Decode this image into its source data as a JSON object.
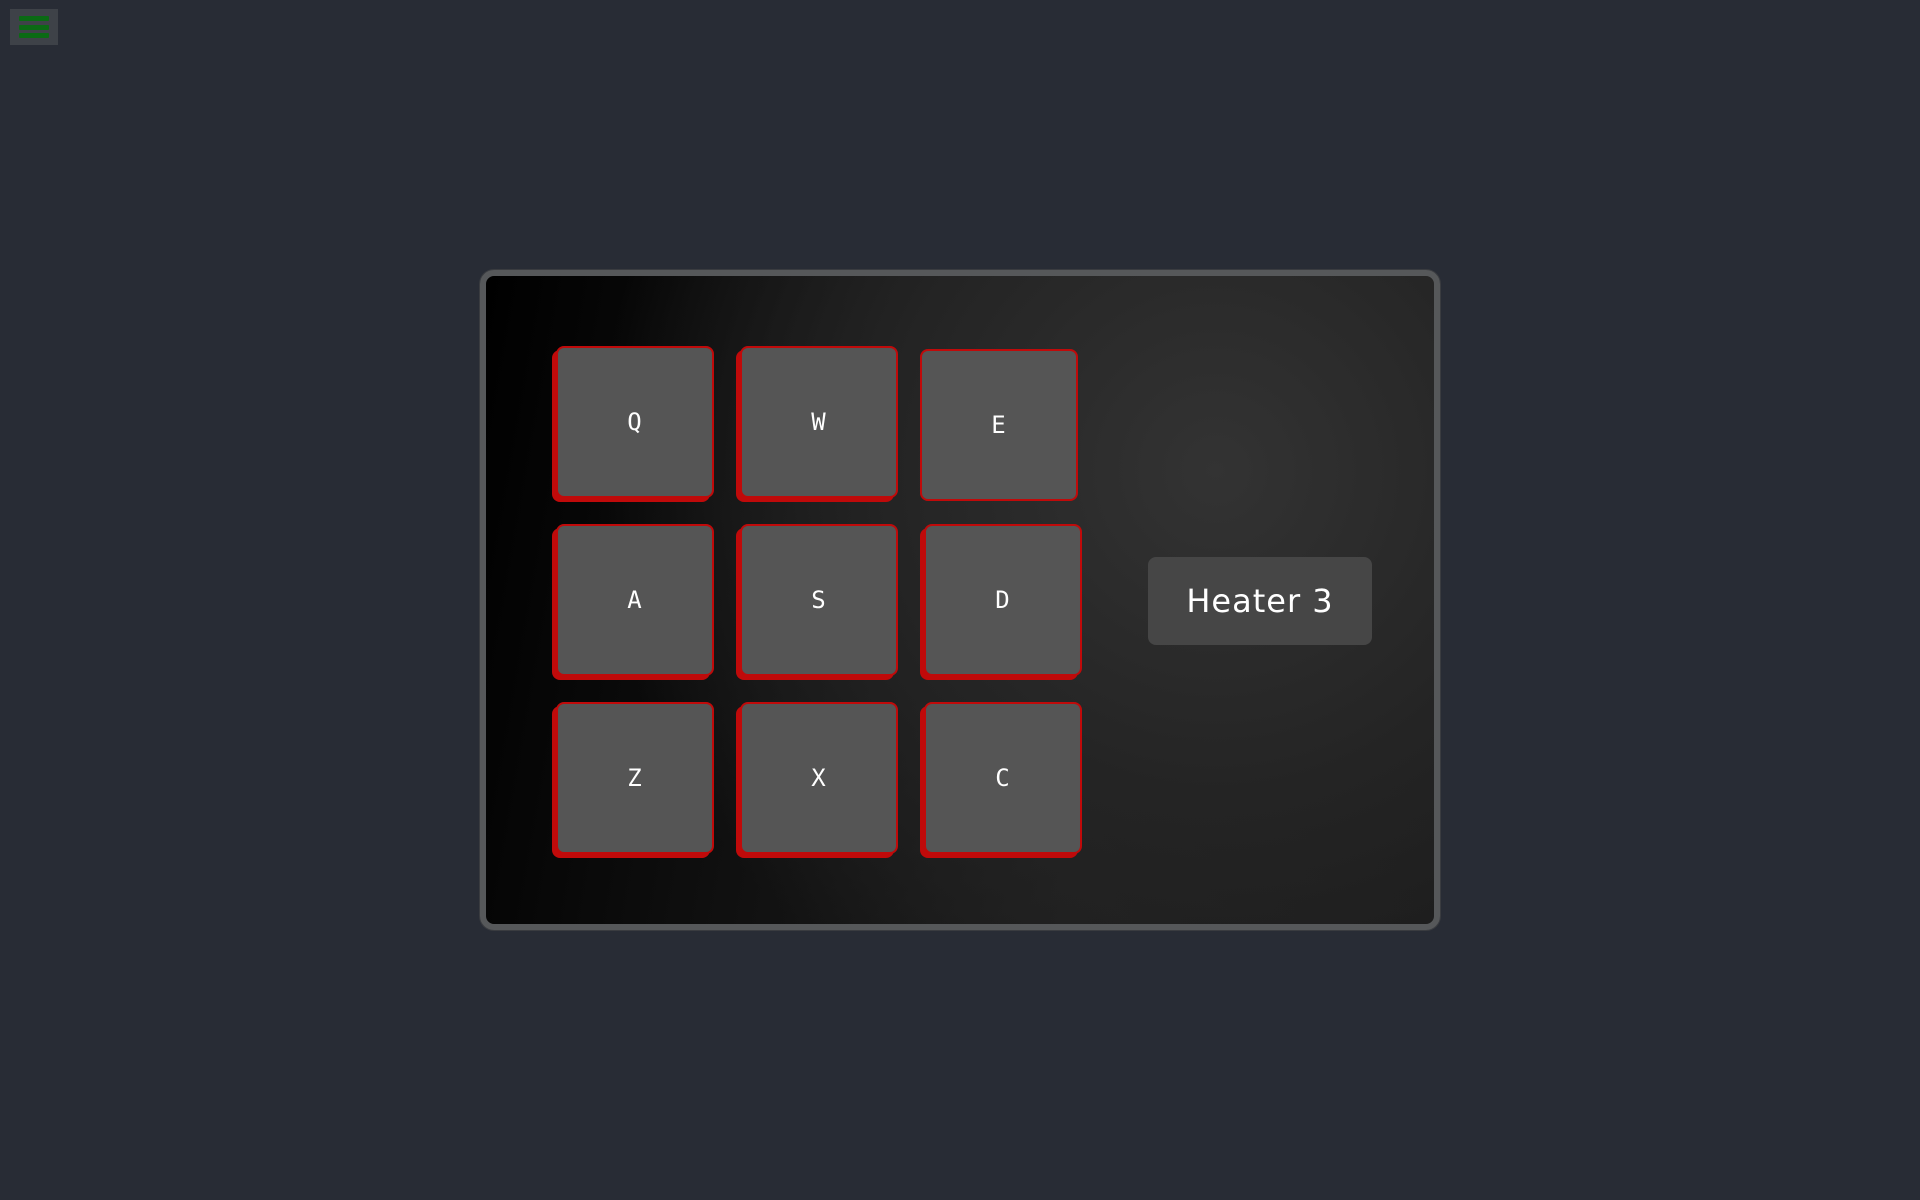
{
  "menu": {
    "icon": "hamburger-menu-icon",
    "bar_color": "#0b6a14"
  },
  "colors": {
    "background": "#282c35",
    "panel_border": "#56585a",
    "key_face": "#555555",
    "key_accent": "#c00a0a",
    "label_bg": "#464646"
  },
  "keypad": {
    "keys": [
      {
        "label": "Q"
      },
      {
        "label": "W"
      },
      {
        "label": "E"
      },
      {
        "label": "A"
      },
      {
        "label": "S"
      },
      {
        "label": "D"
      },
      {
        "label": "Z"
      },
      {
        "label": "X"
      },
      {
        "label": "C"
      }
    ]
  },
  "device": {
    "label": "Heater 3"
  }
}
